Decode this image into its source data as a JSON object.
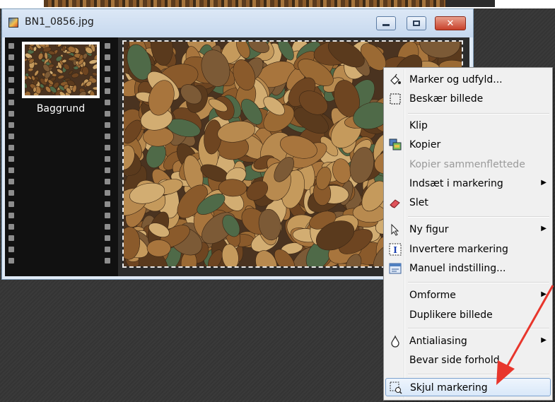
{
  "window": {
    "title": "BN1_0856.jpg",
    "icons": {
      "doc": "image-file-icon",
      "minimize": "minimize-icon",
      "maximize": "maximize-icon",
      "close": "close-icon"
    }
  },
  "filmstrip": {
    "layer_label": "Baggrund"
  },
  "context_menu": {
    "items": [
      {
        "label": "Marker og udfyld...",
        "icon": "fill-selection-icon"
      },
      {
        "label": "Beskær billede",
        "icon": "crop-icon"
      },
      {
        "label": "Klip",
        "icon": ""
      },
      {
        "label": "Kopier",
        "icon": "copy-icon"
      },
      {
        "label": "Kopier sammenflettede",
        "icon": "",
        "disabled": true
      },
      {
        "label": "Indsæt i markering",
        "icon": "",
        "submenu": true
      },
      {
        "label": "Slet",
        "icon": "eraser-icon"
      },
      {
        "label": "Ny figur",
        "icon": "pointer-icon",
        "submenu": true
      },
      {
        "label": "Invertere markering",
        "icon": "invert-selection-icon"
      },
      {
        "label": "Manuel indstilling...",
        "icon": "manual-settings-icon"
      },
      {
        "label": "Omforme",
        "icon": "",
        "submenu": true
      },
      {
        "label": "Duplikere billede",
        "icon": ""
      },
      {
        "label": "Antialiasing",
        "icon": "droplet-icon",
        "submenu": true
      },
      {
        "label": "Bevar side forhold",
        "icon": ""
      },
      {
        "label": "Skjul markering",
        "icon": "hide-selection-icon",
        "highlighted": true
      }
    ],
    "submenu_arrow": "▶"
  },
  "colors": {
    "annotation_arrow": "#e8362c",
    "menu_highlight_border": "#7da2ce",
    "close_button": "#c7402a"
  }
}
